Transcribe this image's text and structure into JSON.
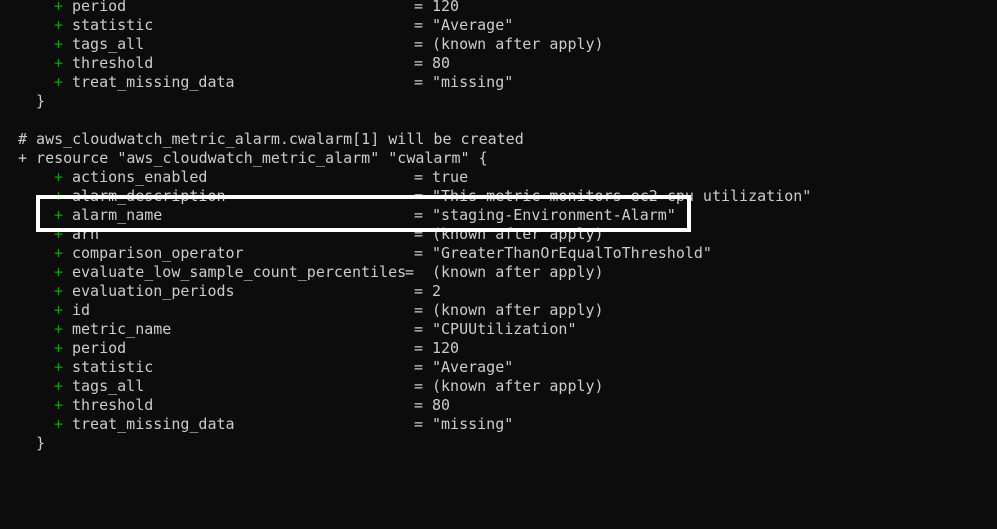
{
  "terminal": {
    "top_block": [
      {
        "attr": "period",
        "value": "120"
      },
      {
        "attr": "statistic",
        "value": "\"Average\""
      },
      {
        "attr": "tags_all",
        "value": "(known after apply)"
      },
      {
        "attr": "threshold",
        "value": "80"
      },
      {
        "attr": "treat_missing_data",
        "value": "\"missing\""
      }
    ],
    "close_brace": "}",
    "comment": "# aws_cloudwatch_metric_alarm.cwalarm[1] will be created",
    "resource_line": "+ resource \"aws_cloudwatch_metric_alarm\" \"cwalarm\" {",
    "resource_block": [
      {
        "attr": "actions_enabled",
        "value": "true"
      },
      {
        "attr": "alarm_description",
        "value": "\"This metric monitors ec2 cpu utilization\""
      },
      {
        "attr": "alarm_name",
        "value": "\"staging-Environment-Alarm\""
      },
      {
        "attr": "arn",
        "value": "(known after apply)"
      },
      {
        "attr": "comparison_operator",
        "value": "\"GreaterThanOrEqualToThreshold\""
      },
      {
        "attr": "evaluate_low_sample_count_percentiles",
        "value": "(known after apply)"
      },
      {
        "attr": "evaluation_periods",
        "value": "2"
      },
      {
        "attr": "id",
        "value": "(known after apply)"
      },
      {
        "attr": "metric_name",
        "value": "\"CPUUtilization\""
      },
      {
        "attr": "period",
        "value": "120"
      },
      {
        "attr": "statistic",
        "value": "\"Average\""
      },
      {
        "attr": "tags_all",
        "value": "(known after apply)"
      },
      {
        "attr": "threshold",
        "value": "80"
      },
      {
        "attr": "treat_missing_data",
        "value": "\"missing\""
      }
    ],
    "final_brace": "}",
    "plus_sign": "+",
    "equals_sign": "="
  },
  "colors": {
    "background": "#0c0c0c",
    "text": "#cccccc",
    "plus": "#13a10e",
    "highlight_box": "#ffffff"
  }
}
